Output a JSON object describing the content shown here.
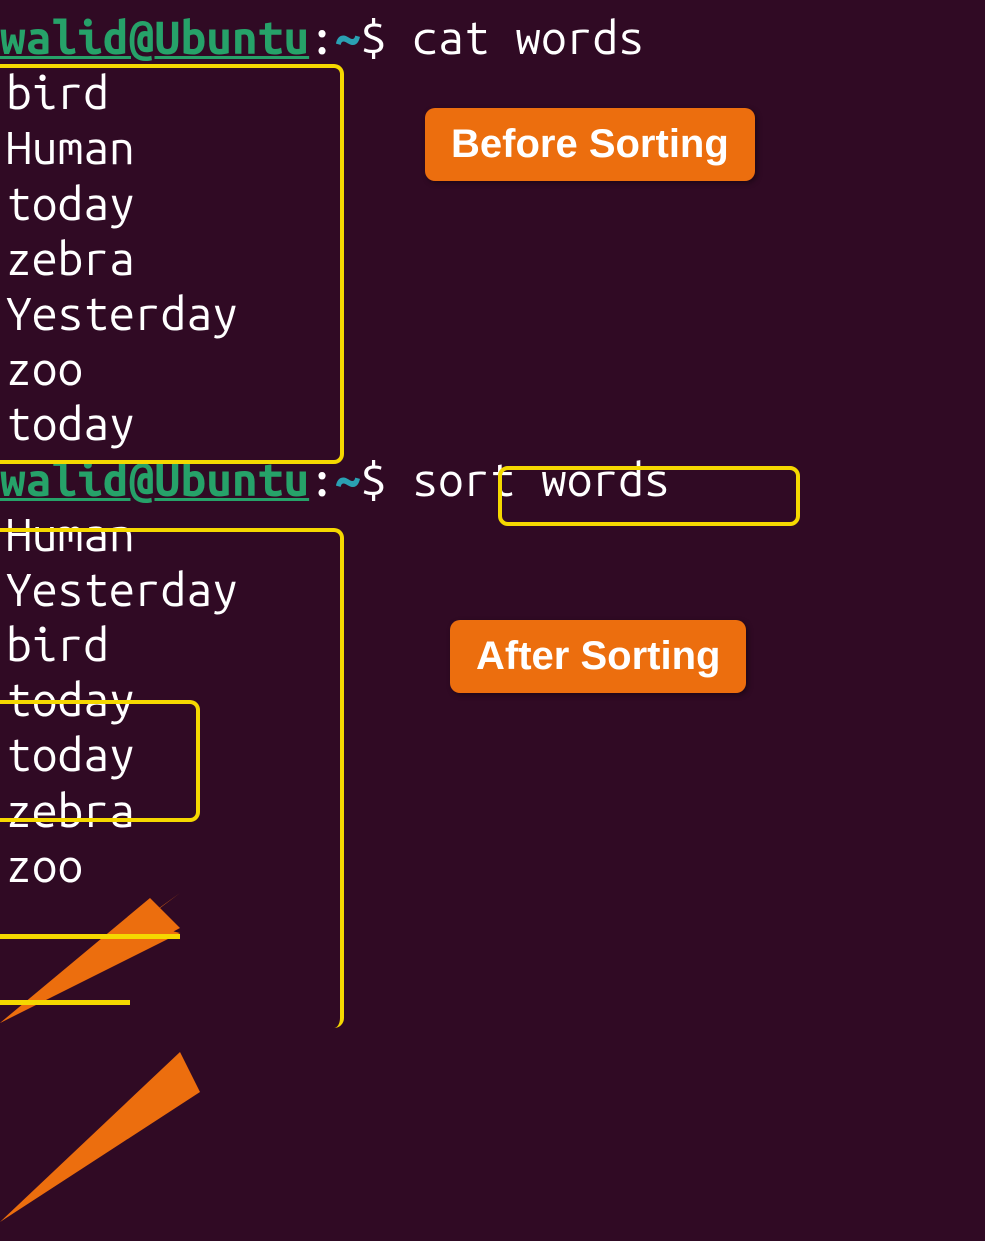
{
  "prompt": {
    "user": "walid@Ubuntu",
    "colon": ":",
    "path": "~",
    "dollar": "$"
  },
  "command1": "cat words",
  "output1": [
    "bird",
    "Human",
    "today",
    "zebra",
    "Yesterday",
    "zoo",
    "today"
  ],
  "command2": "sort words",
  "output2": [
    "Human",
    "Yesterday",
    "bird",
    "today",
    "today",
    "zebra",
    "zoo"
  ],
  "callouts": {
    "before": "Before Sorting",
    "after": "After Sorting"
  }
}
